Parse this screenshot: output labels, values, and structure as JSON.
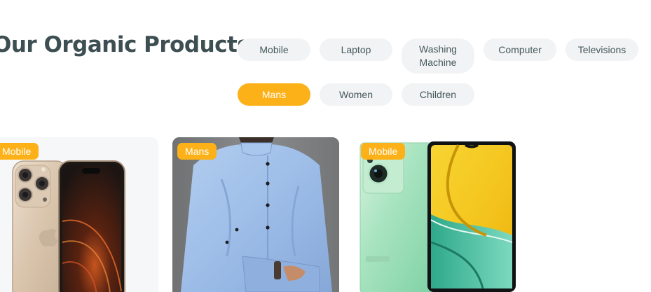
{
  "section": {
    "title": "Our Organic Products"
  },
  "tabs": [
    {
      "label": "Mobile"
    },
    {
      "label": "Laptop"
    },
    {
      "label": "Washing Machine"
    },
    {
      "label": "Computer"
    },
    {
      "label": "Televisions"
    },
    {
      "label": "Mans",
      "active": true
    },
    {
      "label": "Women"
    },
    {
      "label": "Children"
    }
  ],
  "products": [
    {
      "badge": "Mobile",
      "image": "iphone-icon"
    },
    {
      "badge": "Mans",
      "image": "shirt-model-icon"
    },
    {
      "badge": "Mobile",
      "image": "realme-phone-icon"
    }
  ],
  "colors": {
    "accent": "#fdb118",
    "pill_bg": "#f2f3f5",
    "title": "#3d4f53"
  }
}
